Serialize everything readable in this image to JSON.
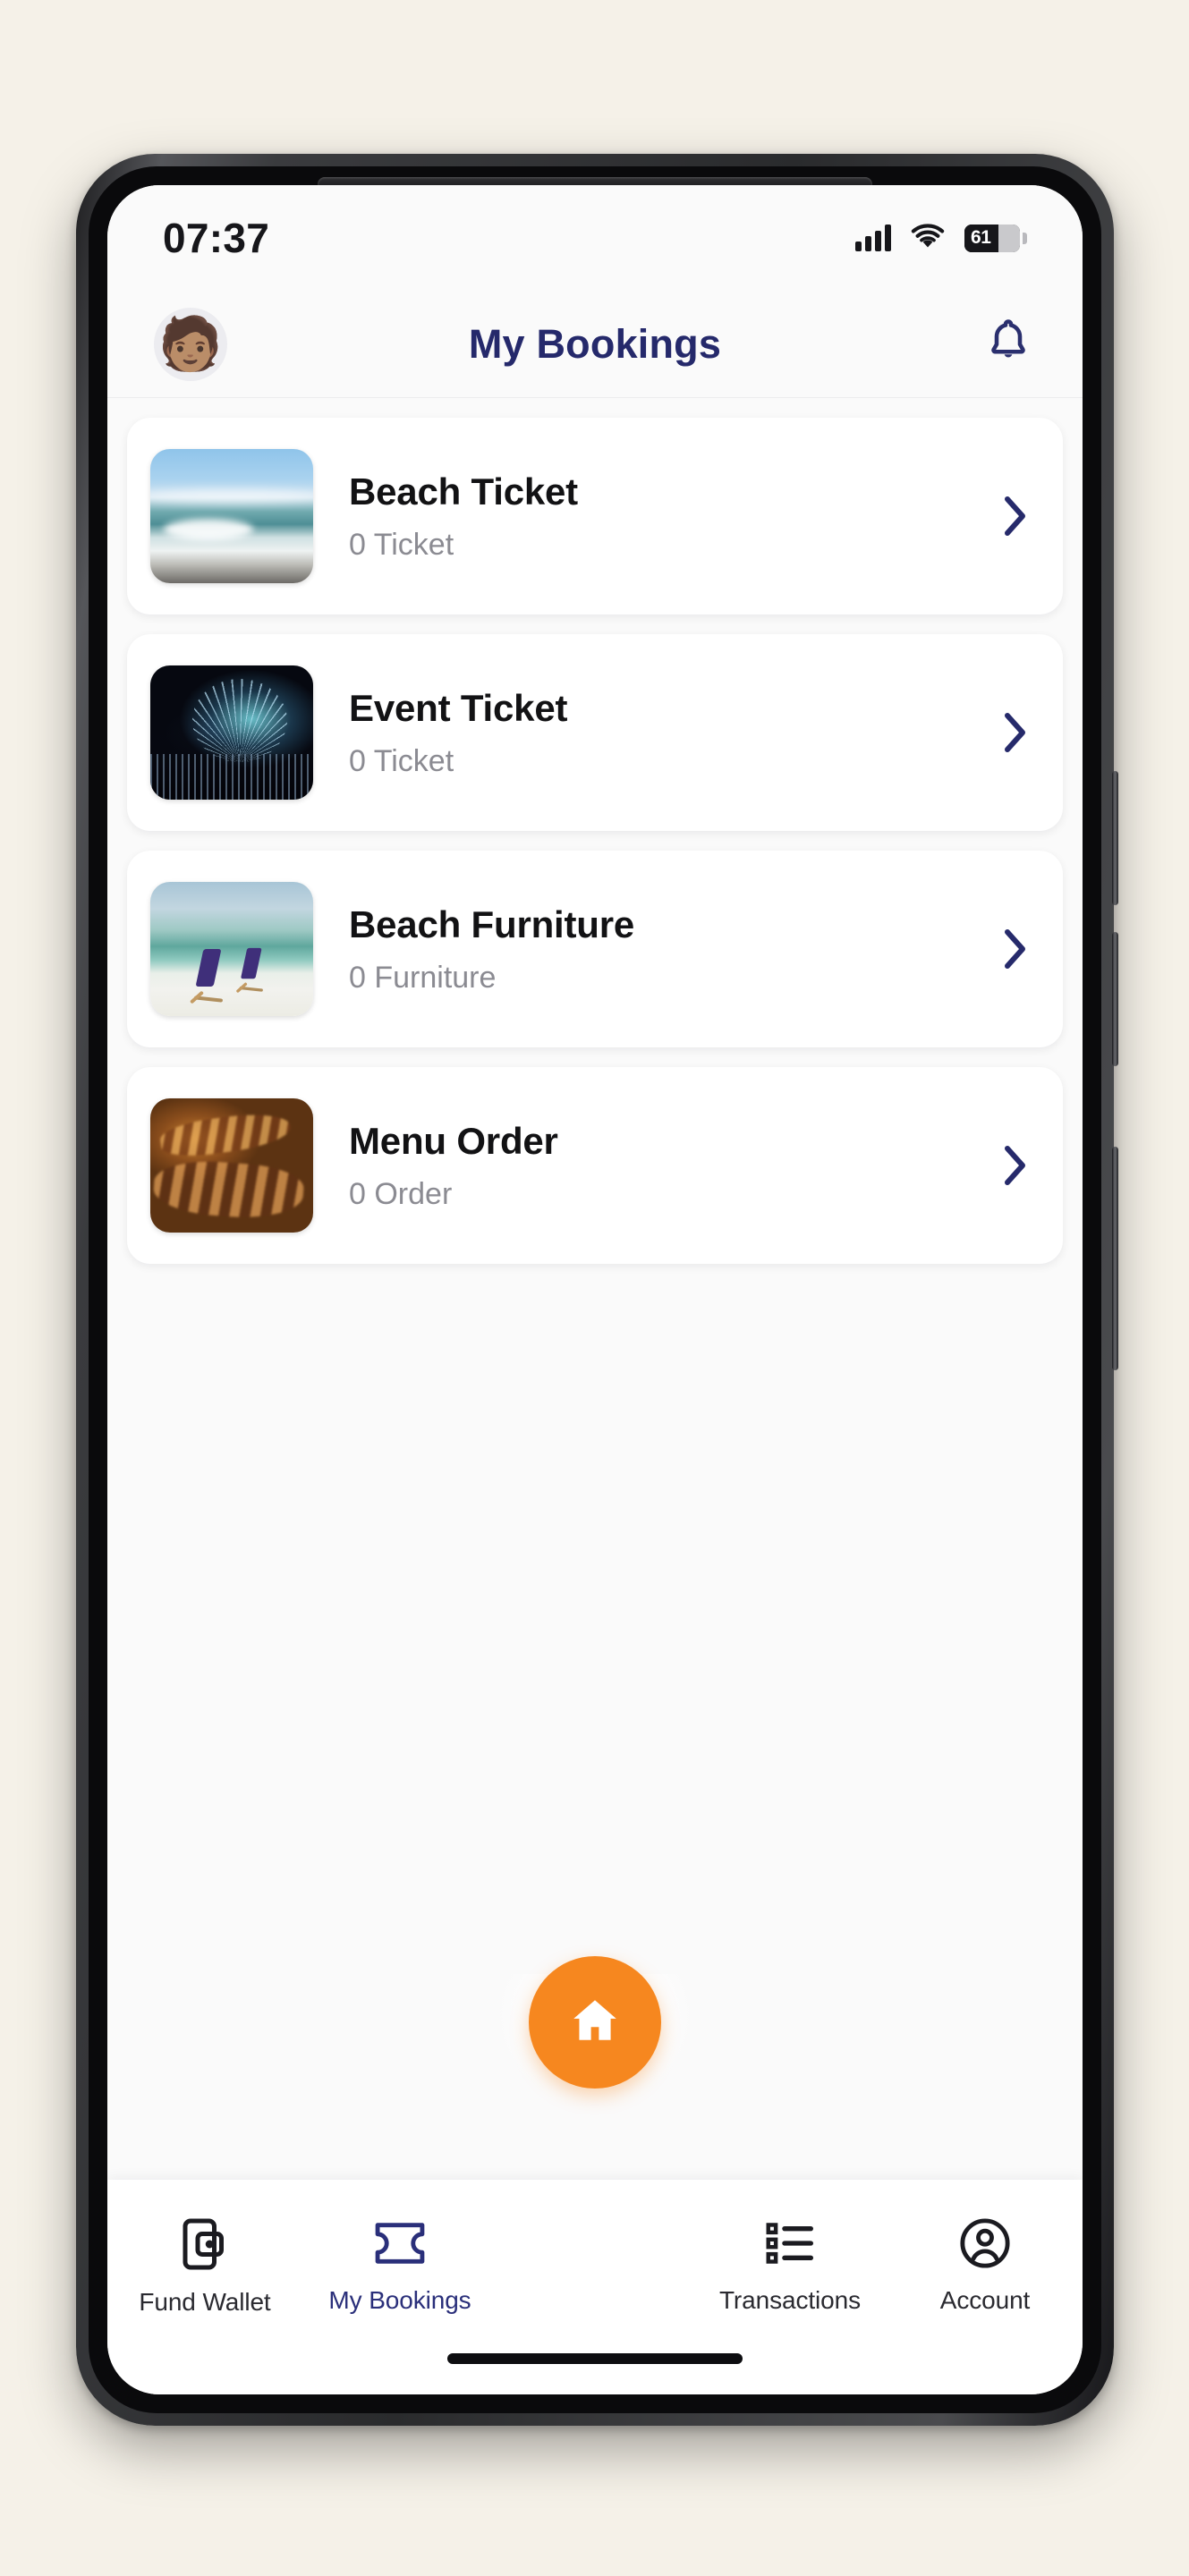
{
  "status_bar": {
    "time": "07:37",
    "battery_level": "61",
    "signal_icon": "signal-bars-icon",
    "wifi_icon": "wifi-icon",
    "battery_icon": "battery-icon"
  },
  "header": {
    "title": "My Bookings",
    "avatar_icon": "avatar-memoji",
    "avatar_glyph": "🧑🏽",
    "notification_icon": "bell-icon"
  },
  "colors": {
    "accent_navy": "#25296b",
    "accent_orange": "#f6871f",
    "card_bg": "#ffffff",
    "screen_bg": "#fafafa",
    "page_bg": "#f5f1e8",
    "muted_text": "#8b8b92"
  },
  "bookings": [
    {
      "title": "Beach Ticket",
      "count": "0 Ticket",
      "thumb_icon": "beach-wave-thumbnail",
      "chevron_icon": "chevron-right-icon"
    },
    {
      "title": "Event Ticket",
      "count": "0 Ticket",
      "thumb_icon": "concert-stage-thumbnail",
      "chevron_icon": "chevron-right-icon"
    },
    {
      "title": "Beach Furniture",
      "count": "0 Furniture",
      "thumb_icon": "beach-chairs-thumbnail",
      "chevron_icon": "chevron-right-icon"
    },
    {
      "title": "Menu Order",
      "count": "0 Order",
      "thumb_icon": "grilled-food-thumbnail",
      "chevron_icon": "chevron-right-icon"
    }
  ],
  "fab": {
    "icon": "home-icon",
    "color": "#f6871f"
  },
  "bottom_nav": [
    {
      "label": "Fund Wallet",
      "icon": "wallet-phone-icon",
      "active": false
    },
    {
      "label": "My Bookings",
      "icon": "ticket-icon",
      "active": true
    },
    {
      "label": "Transactions",
      "icon": "list-icon",
      "active": false
    },
    {
      "label": "Account",
      "icon": "user-circle-icon",
      "active": false
    }
  ]
}
